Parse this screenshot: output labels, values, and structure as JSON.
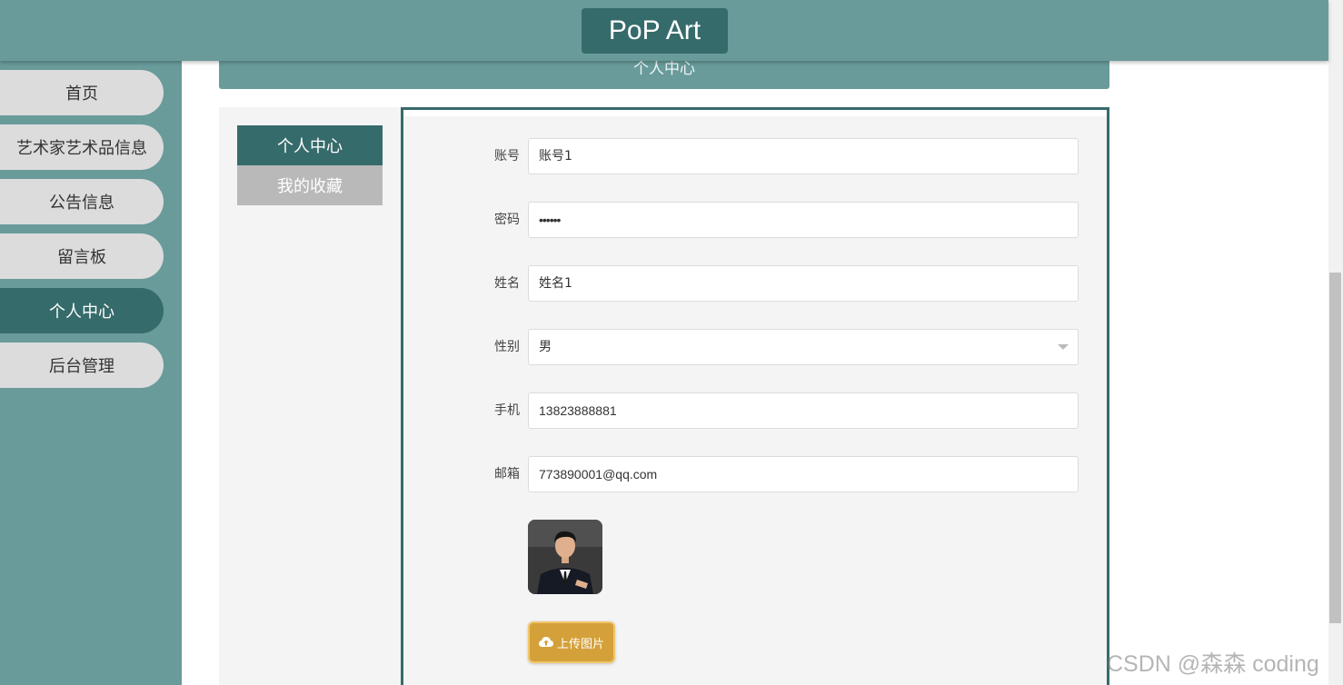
{
  "header": {
    "logo": "PoP Art"
  },
  "banner": {
    "title": "个人中心"
  },
  "sidebar": {
    "items": [
      {
        "label": "首页",
        "active": false
      },
      {
        "label": "艺术家艺术品信息",
        "active": false
      },
      {
        "label": "公告信息",
        "active": false
      },
      {
        "label": "留言板",
        "active": false
      },
      {
        "label": "个人中心",
        "active": true
      },
      {
        "label": "后台管理",
        "active": false
      }
    ]
  },
  "subnav": {
    "items": [
      {
        "label": "个人中心",
        "active": true
      },
      {
        "label": "我的收藏",
        "active": false
      }
    ]
  },
  "form": {
    "account": {
      "label": "账号",
      "value": "账号1"
    },
    "password": {
      "label": "密码",
      "value": "••••••"
    },
    "name": {
      "label": "姓名",
      "value": "姓名1"
    },
    "gender": {
      "label": "性别",
      "value": "男"
    },
    "phone": {
      "label": "手机",
      "value": "13823888881"
    },
    "email": {
      "label": "邮箱",
      "value": "773890001@qq.com"
    },
    "upload_label": "上传图片"
  },
  "watermark": "CSDN @森森 coding",
  "colors": {
    "primary": "#366b6b",
    "sidebar": "#689b9a",
    "upload": "#d4a03a"
  }
}
